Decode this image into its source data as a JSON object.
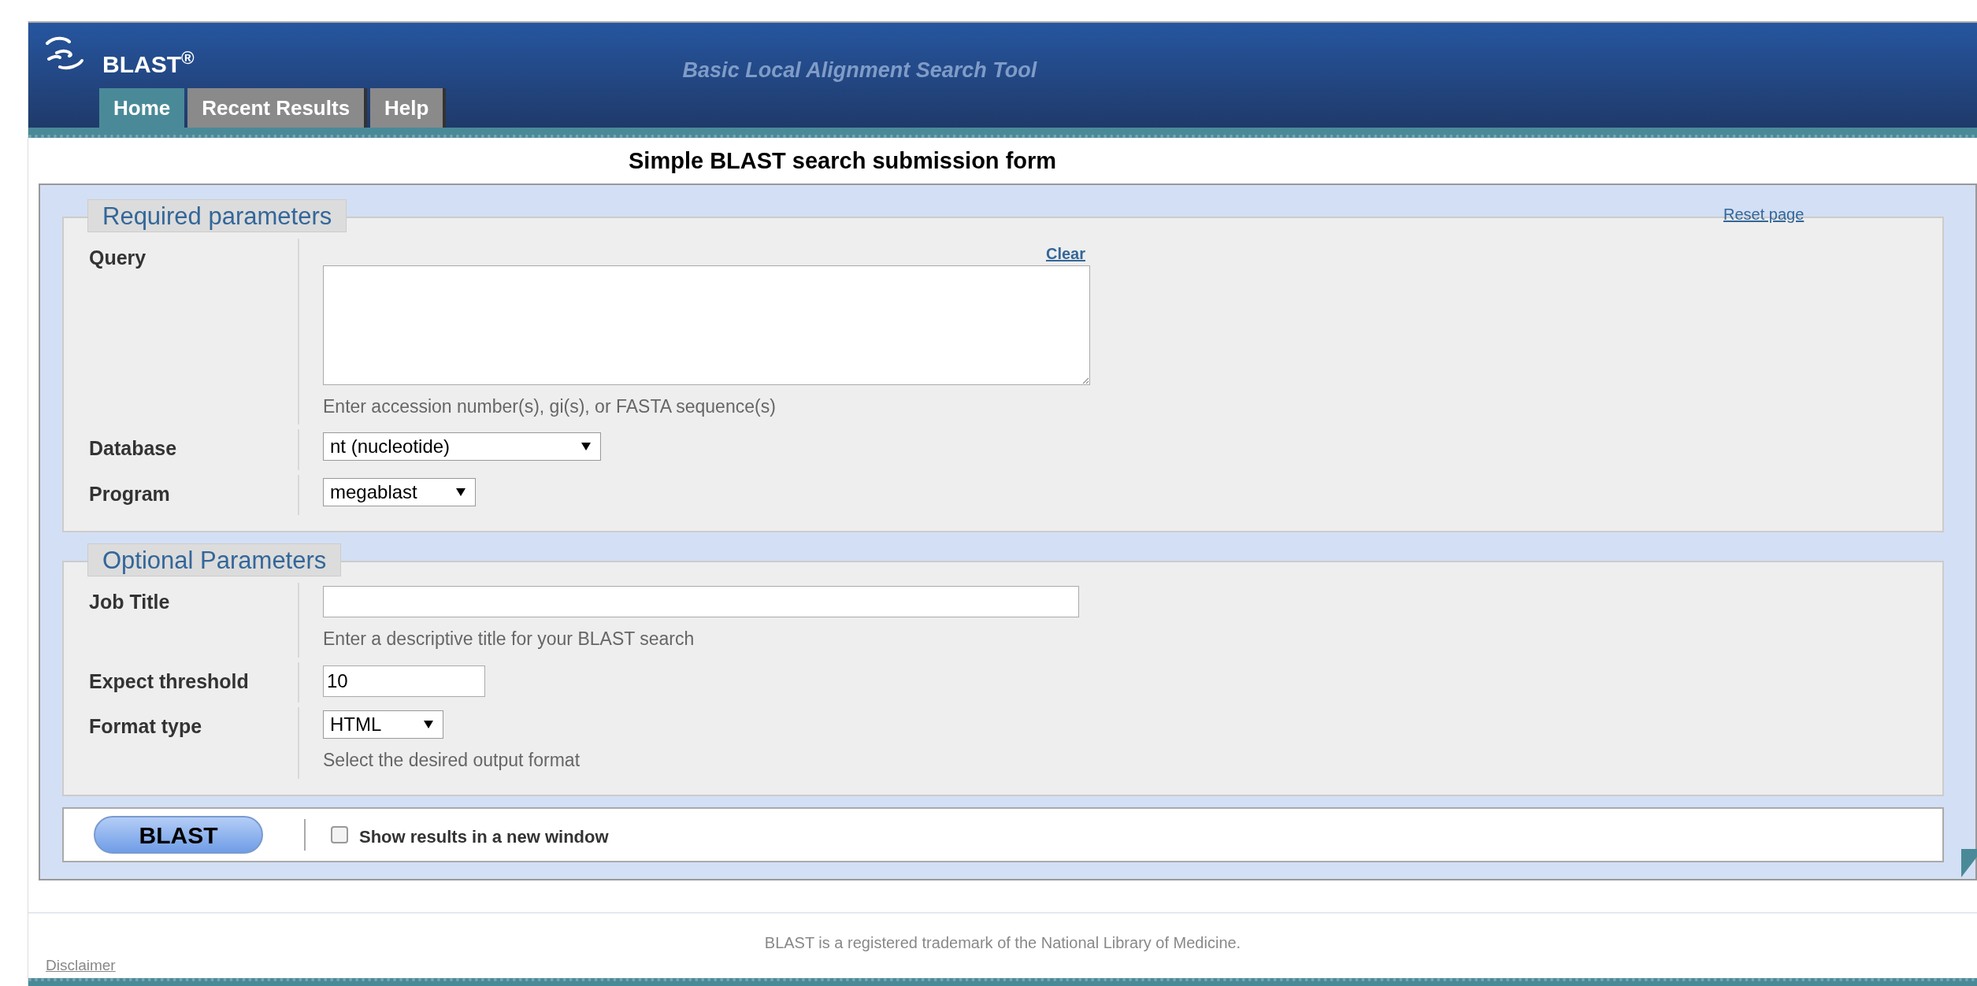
{
  "header": {
    "logo": "BLAST$^{®}$",
    "subtitle": "Basic Local Alignment Search Tool"
  },
  "tabs": [
    {
      "label": "Home",
      "selected": true
    },
    {
      "label": "Recent Results",
      "selected": false
    },
    {
      "label": "Help",
      "selected": false
    }
  ],
  "form_title": "Simple BLAST search submission form",
  "reset_link": "Reset page",
  "sections": [
    {
      "legend": "Required parameters",
      "rows": [
        {
          "kind": "textarea",
          "label": "Query",
          "link": "Clear",
          "hint": "Enter accession number(s), gi(s), or FASTA sequence(s)"
        },
        {
          "kind": "select",
          "label": "Database",
          "value": "nt (nucleotide)"
        },
        {
          "kind": "select",
          "label": "Program",
          "value": "megablast"
        }
      ]
    },
    {
      "legend": "Optional Parameters",
      "rows": [
        {
          "kind": "input",
          "label": "Job Title",
          "hint": "Enter a descriptive title for your BLAST search"
        },
        {
          "kind": "input",
          "label": "Expect threshold",
          "value": "10"
        },
        {
          "kind": "select",
          "label": "Format type",
          "value": "HTML",
          "hint": "Select the desired output format"
        }
      ]
    }
  ],
  "submit": {
    "button": "BLAST",
    "checkbox_label": "Show results in a new window",
    "checked": false
  },
  "footer": {
    "trademark": "BLAST is a registered trademark of the National Library of Medicine.",
    "disclaimer": "Disclaimer"
  }
}
